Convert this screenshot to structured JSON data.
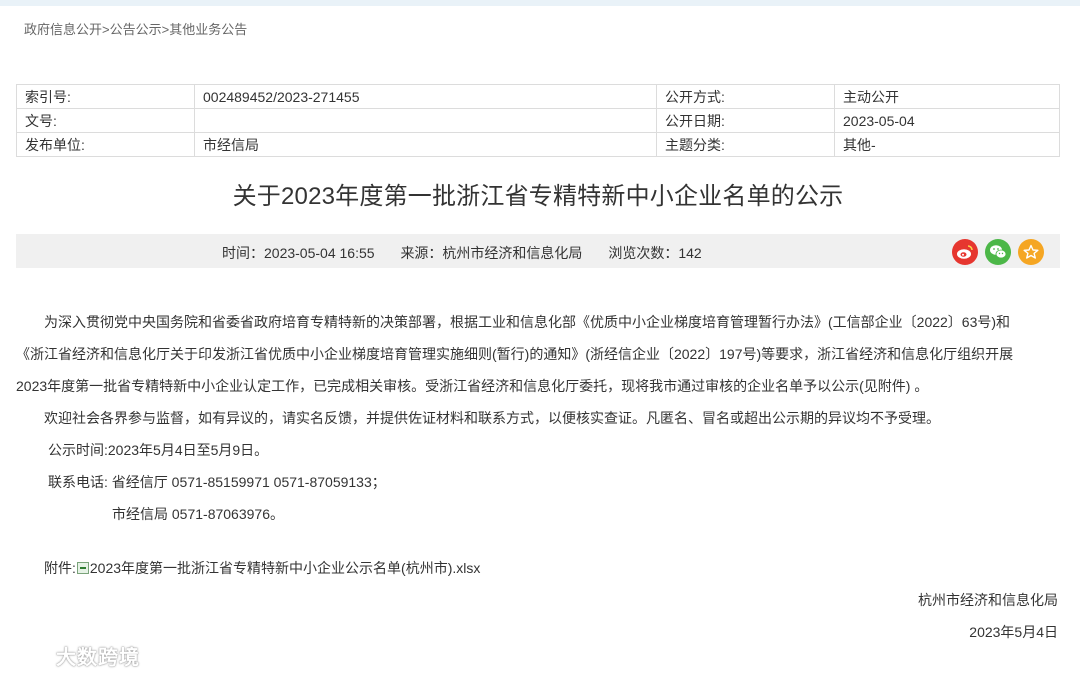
{
  "breadcrumb": {
    "level1": "政府信息公开",
    "level2": "公告公示",
    "level3": "其他业务公告",
    "separator": ">"
  },
  "meta": {
    "index_label": "索引号:",
    "index_value": "002489452/2023-271455",
    "method_label": "公开方式:",
    "method_value": "主动公开",
    "docno_label": "文号:",
    "docno_value": "",
    "date_label": "公开日期:",
    "date_value": "2023-05-04",
    "publisher_label": "发布单位:",
    "publisher_value": "市经信局",
    "topic_label": "主题分类:",
    "topic_value": "其他-"
  },
  "title": "关于2023年度第一批浙江省专精特新中小企业名单的公示",
  "infobar": {
    "time": "时间：2023-05-04 16:55",
    "source": "来源：杭州市经济和信息化局",
    "views": "浏览次数：142",
    "share_icons": [
      "weibo-icon",
      "wechat-icon",
      "favorite-icon"
    ],
    "colors": {
      "weibo": "#e6362f",
      "wechat": "#4cb748",
      "favorite": "#f5a623"
    }
  },
  "content": {
    "p1_line1": "为深入贯彻党中央国务院和省委省政府培育专精特新的决策部署，根据工业和信息化部《优质中小企业梯度培育管理暂行办法》(工信部企业〔2022〕63号)和",
    "p1_line2": "《浙江省经济和信息化厅关于印发浙江省优质中小企业梯度培育管理实施细则(暂行)的通知》(浙经信企业〔2022〕197号)等要求，浙江省经济和信息化厅组织开展",
    "p1_line3": "2023年度第一批省专精特新中小企业认定工作，已完成相关审核。受浙江省经济和信息化厅委托，现将我市通过审核的企业名单予以公示(见附件) 。",
    "p2": "欢迎社会各界参与监督，如有异议的，请实名反馈，并提供佐证材料和联系方式，以便核实查证。凡匿名、冒名或超出公示期的异议均不予受理。",
    "p3": "公示时间:2023年5月4日至5月9日。",
    "p4": "联系电话: 省经信厅 0571-85159971 0571-87059133；",
    "p5": "市经信局 0571-87063976。"
  },
  "attachment": {
    "label": "附件:",
    "filename": "2023年度第一批浙江省专精特新中小企业公示名单(杭州市).xlsx"
  },
  "signature": {
    "org": "杭州市经济和信息化局",
    "date": "2023年5月4日"
  },
  "watermark": {
    "text": "大数跨境"
  }
}
